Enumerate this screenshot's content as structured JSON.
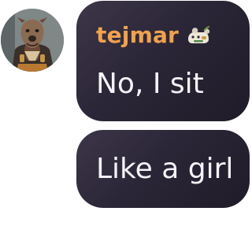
{
  "message_group": {
    "author": {
      "username": "tejmar",
      "avatar_icon": "dog-firefighter-avatar",
      "badge_icon": "dog-badge-icon"
    },
    "messages": [
      {
        "text": "No, I sit"
      },
      {
        "text": "Like a girl"
      }
    ]
  },
  "colors": {
    "username": "#f0a24f",
    "bubble_background": "#2b2637",
    "message_text": "#f5f3f8"
  }
}
